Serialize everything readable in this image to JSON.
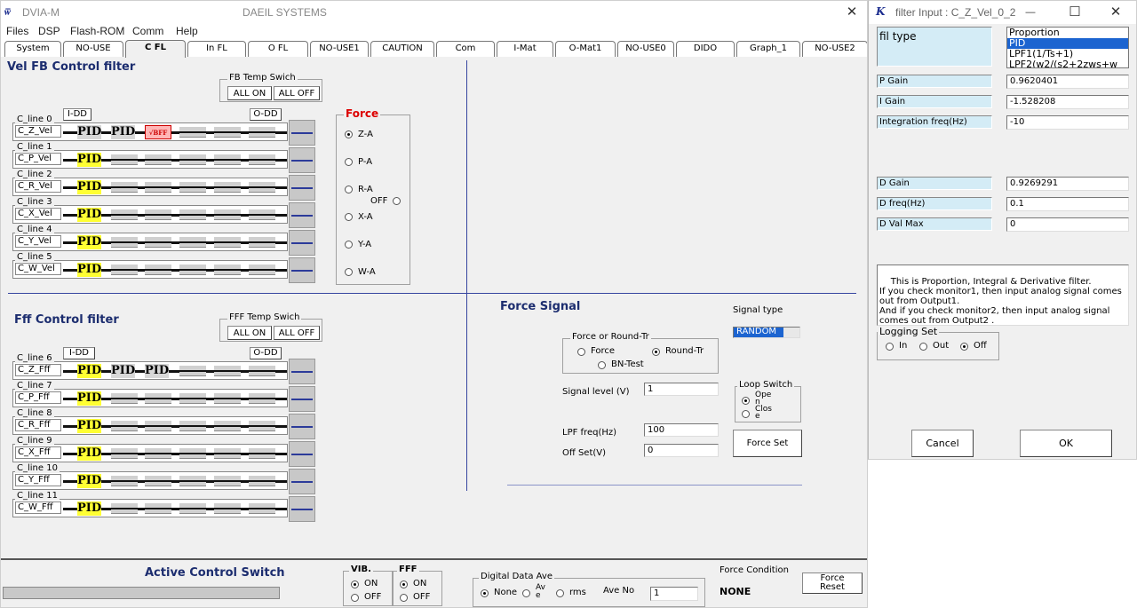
{
  "main": {
    "title": "DVIA-M",
    "company": "DAEIL SYSTEMS",
    "close_glyph": "✕",
    "menu": [
      "Files",
      "DSP",
      "Flash-ROM",
      "Comm",
      "Help"
    ],
    "tabs": [
      "System",
      "NO-USE",
      "C FL",
      "In FL",
      "O FL",
      "NO-USE1",
      "CAUTION",
      "Com",
      "I-Mat",
      "O-Mat1",
      "NO-USE0",
      "DIDO",
      "Graph_1",
      "NO-USE2"
    ],
    "active_tab": "C FL",
    "vel_title": "Vel FB Control filter",
    "fb_temp": {
      "title": "FB Temp Swich",
      "all_on": "ALL ON",
      "all_off": "ALL OFF"
    },
    "idd": "I-DD",
    "odd": "O-DD",
    "vel_rows": [
      {
        "line": "C_line 0",
        "name": "C_Z_Vel"
      },
      {
        "line": "C_line 1",
        "name": "C_P_Vel"
      },
      {
        "line": "C_line 2",
        "name": "C_R_Vel"
      },
      {
        "line": "C_line 3",
        "name": "C_X_Vel"
      },
      {
        "line": "C_line 4",
        "name": "C_Y_Vel"
      },
      {
        "line": "C_line 5",
        "name": "C_W_Vel"
      }
    ],
    "pid_text": "PID",
    "bff_text": "√BFF",
    "force": {
      "title": "Force",
      "options": [
        "Z-A",
        "P-A",
        "R-A",
        "X-A",
        "Y-A",
        "W-A"
      ],
      "selected": "Z-A",
      "off_label": "OFF"
    },
    "fff_title": "Fff Control filter",
    "fff_temp": {
      "title": "FFF Temp Swich",
      "all_on": "ALL ON",
      "all_off": "ALL OFF"
    },
    "fff_rows": [
      {
        "line": "C_line 6",
        "name": "C_Z_Fff"
      },
      {
        "line": "C_line 7",
        "name": "C_P_Fff"
      },
      {
        "line": "C_line 8",
        "name": "C_R_Fff"
      },
      {
        "line": "C_line 9",
        "name": "C_X_Fff"
      },
      {
        "line": "C_line 10",
        "name": "C_Y_Fff"
      },
      {
        "line": "C_line 11",
        "name": "C_W_Fff"
      }
    ],
    "force_signal": {
      "title": "Force Signal",
      "signal_type_label": "Signal type",
      "signal_type_value": "RANDOM",
      "mode_group": "Force or Round-Tr",
      "mode_force": "Force",
      "mode_round": "Round-Tr",
      "mode_bn": "BN-Test",
      "signal_level_label": "Signal level (V)",
      "signal_level_value": "1",
      "loop_switch": "Loop Switch",
      "loop_open": "Ope\nn",
      "loop_close": "Clos\ne",
      "lpf_label": "LPF freq(Hz)",
      "lpf_value": "100",
      "offset_label": "Off Set(V)",
      "offset_value": "0",
      "force_set": "Force Set"
    },
    "bottom": {
      "active_switch": "Active Control Switch",
      "vib": "VIB.",
      "fff": "FFF",
      "on": "ON",
      "off": "OFF",
      "digital_ave": "Digital Data Ave",
      "none": "None",
      "ave": "Av\ne",
      "rms": "rms",
      "ave_no_label": "Ave No",
      "ave_no_value": "1",
      "force_condition_label": "Force Condition",
      "force_condition_value": "NONE",
      "force_reset": "Force\nReset"
    }
  },
  "dialog": {
    "title": "filter Input : C_Z_Vel_0_2",
    "min_glyph": "—",
    "max_glyph": "☐",
    "close_glyph": "✕",
    "fil_type_label": "fil type",
    "fil_options": [
      "Proportion",
      "PID",
      "LPF1(1/Ts+1)",
      "LPF2(w2/(s2+2zws+w"
    ],
    "fil_selected": "PID",
    "params": [
      {
        "label": "P Gain",
        "value": "0.9620401"
      },
      {
        "label": "I Gain",
        "value": "-1.528208"
      },
      {
        "label": "Integration freq(Hz)",
        "value": "-10"
      },
      {
        "label": "D Gain",
        "value": "0.9269291"
      },
      {
        "label": "D freq(Hz)",
        "value": "0.1"
      },
      {
        "label": "D Val Max",
        "value": "0"
      }
    ],
    "description": "This is Proportion, Integral & Derivative filter.\nIf you check monitor1, then input analog signal comes out from Output1.\nAnd if you check monitor2, then input analog signal comes out from Output2 .",
    "logging": {
      "title": "Logging Set",
      "in": "In",
      "out": "Out",
      "off": "Off",
      "selected": "Off"
    },
    "cancel": "Cancel",
    "ok": "OK"
  }
}
